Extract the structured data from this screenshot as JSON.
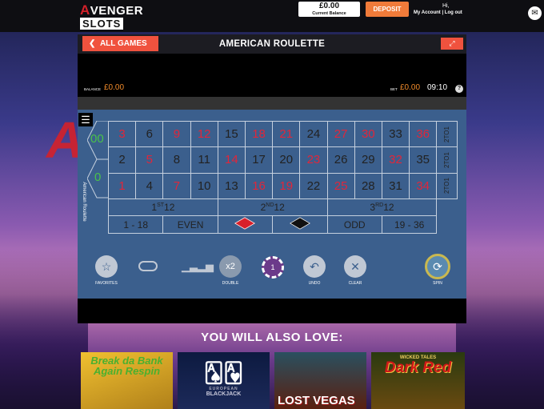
{
  "header": {
    "logo_top": "VENGER",
    "logo_top_a": "A",
    "logo_bottom": "SLOTS",
    "balance_value": "£0.00",
    "balance_label": "Current Balance",
    "deposit_label": "DEPOSIT",
    "greeting": "Hi,",
    "account_links": "My Account | Log out"
  },
  "game": {
    "back_label": "ALL GAMES",
    "title": "AMERICAN ROULETTE",
    "balance_label": "BALANCE",
    "balance_value": "£0.00",
    "bet_label": "BET",
    "bet_value": "£0.00",
    "time": "09:10",
    "help": "?",
    "table_label": "American Roulette",
    "zeros": [
      "00",
      "0"
    ],
    "rows": [
      [
        {
          "n": "3",
          "c": "red"
        },
        {
          "n": "6",
          "c": "black"
        },
        {
          "n": "9",
          "c": "red"
        },
        {
          "n": "12",
          "c": "red"
        },
        {
          "n": "15",
          "c": "black"
        },
        {
          "n": "18",
          "c": "red"
        },
        {
          "n": "21",
          "c": "red"
        },
        {
          "n": "24",
          "c": "black"
        },
        {
          "n": "27",
          "c": "red"
        },
        {
          "n": "30",
          "c": "red"
        },
        {
          "n": "33",
          "c": "black"
        },
        {
          "n": "36",
          "c": "red"
        }
      ],
      [
        {
          "n": "2",
          "c": "black"
        },
        {
          "n": "5",
          "c": "red"
        },
        {
          "n": "8",
          "c": "black"
        },
        {
          "n": "11",
          "c": "black"
        },
        {
          "n": "14",
          "c": "red"
        },
        {
          "n": "17",
          "c": "black"
        },
        {
          "n": "20",
          "c": "black"
        },
        {
          "n": "23",
          "c": "red"
        },
        {
          "n": "26",
          "c": "black"
        },
        {
          "n": "29",
          "c": "black"
        },
        {
          "n": "32",
          "c": "red"
        },
        {
          "n": "35",
          "c": "black"
        }
      ],
      [
        {
          "n": "1",
          "c": "red"
        },
        {
          "n": "4",
          "c": "black"
        },
        {
          "n": "7",
          "c": "red"
        },
        {
          "n": "10",
          "c": "black"
        },
        {
          "n": "13",
          "c": "black"
        },
        {
          "n": "16",
          "c": "red"
        },
        {
          "n": "19",
          "c": "red"
        },
        {
          "n": "22",
          "c": "black"
        },
        {
          "n": "25",
          "c": "red"
        },
        {
          "n": "28",
          "c": "black"
        },
        {
          "n": "31",
          "c": "black"
        },
        {
          "n": "34",
          "c": "red"
        }
      ]
    ],
    "column_bets": [
      "2TO1",
      "2TO1",
      "2TO1"
    ],
    "dozens": [
      {
        "num": "1",
        "sup": "ST",
        "suffix": "12"
      },
      {
        "num": "2",
        "sup": "ND",
        "suffix": "12"
      },
      {
        "num": "3",
        "sup": "RD",
        "suffix": "12"
      }
    ],
    "outside": {
      "low": "1 - 18",
      "even": "EVEN",
      "odd": "ODD",
      "high": "19 - 36"
    },
    "controls": {
      "favorites": "FAVORITES",
      "double": "DOUBLE",
      "double_icon": "x2",
      "chip_value": "1",
      "undo": "UNDO",
      "clear": "CLEAR",
      "spin": "SPIN"
    },
    "colors": {
      "red": "#e1263a",
      "black": "#222222",
      "green": "#4ac14a",
      "table": "#3b5f8d",
      "accent": "#f0523e"
    }
  },
  "recommendations": {
    "title": "YOU WILL ALSO LOVE:",
    "games": [
      {
        "text": "Break da Bank Again Respin"
      },
      {
        "brand": "EUROPEAN",
        "name": "BLACKJACK"
      },
      {
        "text": "LOST VEGAS"
      },
      {
        "tag": "WICKED TALES",
        "text": "Dark Red"
      }
    ]
  }
}
